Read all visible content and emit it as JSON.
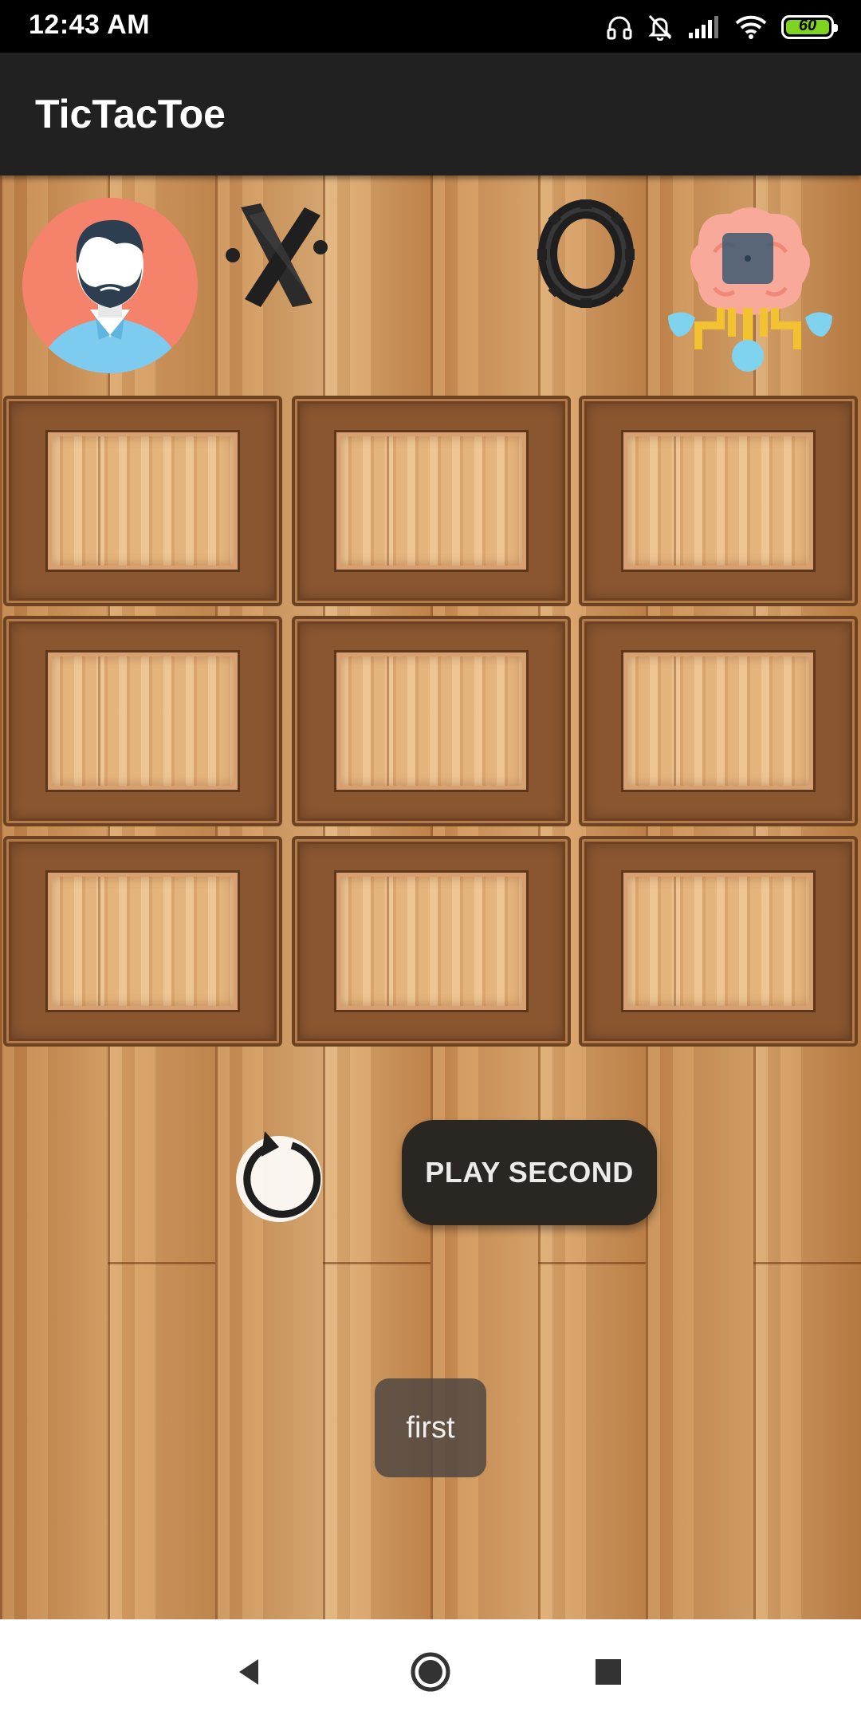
{
  "status_bar": {
    "time": "12:43 AM",
    "battery_level": "60",
    "icons": [
      "headphones-icon",
      "bell-off-icon",
      "signal-icon",
      "wifi-icon",
      "battery-icon"
    ]
  },
  "app_bar": {
    "title": "TicTacToe"
  },
  "players": {
    "human_avatar_icon": "person-avatar-icon",
    "human_symbol": "X",
    "ai_symbol": "O",
    "ai_avatar_icon": "ai-brain-icon"
  },
  "board": {
    "cells": [
      "",
      "",
      "",
      "",
      "",
      "",
      "",
      "",
      ""
    ]
  },
  "controls": {
    "reset_icon": "restart-icon",
    "play_second_label": "PLAY SECOND"
  },
  "toast": {
    "message": "first"
  },
  "nav_bar": {
    "buttons": [
      "back-icon",
      "home-icon",
      "recents-icon"
    ]
  },
  "colors": {
    "app_bar": "#212121",
    "avatar_bg": "#f5826a",
    "button_bg": "#2a2622",
    "wood": "#c68e56",
    "battery": "#7ed321"
  }
}
